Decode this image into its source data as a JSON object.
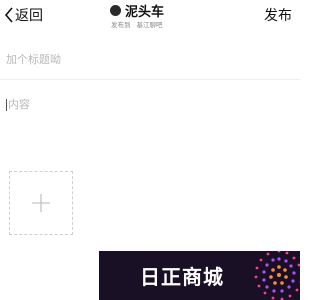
{
  "header": {
    "back_label": "返回",
    "title": "泥头车",
    "sub_prefix": "发布到",
    "sub_target": "基江聊吧",
    "publish_label": "发布"
  },
  "editor": {
    "title_placeholder": "加个标题呦",
    "content_placeholder": "内容"
  },
  "add_media": {
    "icon": "plus-icon"
  },
  "watermark": {
    "text": "日正商城",
    "accent_colors": [
      "#ff3d8b",
      "#b44dff",
      "#ff8a3d"
    ]
  }
}
